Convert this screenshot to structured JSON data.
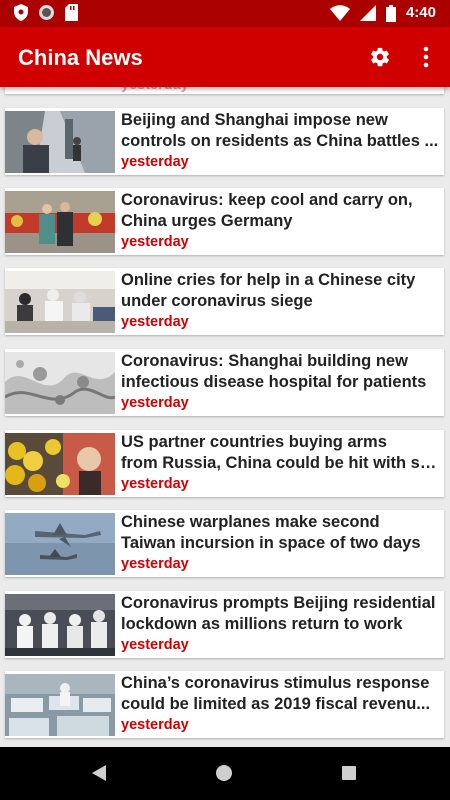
{
  "status_bar": {
    "time": "4:40",
    "icons": [
      "shield-icon",
      "record-icon",
      "sd-card-icon",
      "wifi-icon",
      "signal-icon",
      "battery-icon"
    ]
  },
  "app_bar": {
    "title": "China News",
    "actions": [
      "gear-icon",
      "more-vert-icon"
    ],
    "background": "#d10000"
  },
  "partial_item": {
    "time": "yesterday"
  },
  "articles": [
    {
      "title_line1": "Beijing and Shanghai impose new",
      "title_line2": "controls on residents as China battles ...",
      "time": "yesterday",
      "image": "train-station-photo"
    },
    {
      "title_line1": "Coronavirus: keep cool and carry on,",
      "title_line2": "China urges Germany",
      "time": "yesterday",
      "image": "leaders-flowers-photo"
    },
    {
      "title_line1": "Online cries for help in a Chinese city",
      "title_line2": "under coronavirus siege",
      "time": "yesterday",
      "image": "hospital-crowd-photo"
    },
    {
      "title_line1": "Coronavirus: Shanghai building new",
      "title_line2": "infectious disease hospital for  patients",
      "time": "yesterday",
      "image": "virus-micrograph-photo"
    },
    {
      "title_line1": "US partner countries buying arms",
      "title_line2": "from Russia, China could be hit with sa...",
      "time": "yesterday",
      "image": "flower-memorial-photo"
    },
    {
      "title_line1": "Chinese warplanes make second",
      "title_line2": "Taiwan incursion in space of two days",
      "time": "yesterday",
      "image": "warplanes-photo"
    },
    {
      "title_line1": "Coronavirus prompts Beijing residential",
      "title_line2": "lockdown as millions return to work",
      "time": "yesterday",
      "image": "protective-suits-photo"
    },
    {
      "title_line1": "China’s coronavirus stimulus response",
      "title_line2": "could be limited as 2019 fiscal revenu...",
      "time": "yesterday",
      "image": "hospital-ward-photo"
    }
  ],
  "nav_bar": {
    "buttons": [
      "back-icon",
      "home-icon",
      "recents-icon"
    ]
  },
  "colors": {
    "status_bar": "#aa0000",
    "app_bar": "#d10000",
    "time_text": "#d10000",
    "list_background": "#ebebeb"
  }
}
